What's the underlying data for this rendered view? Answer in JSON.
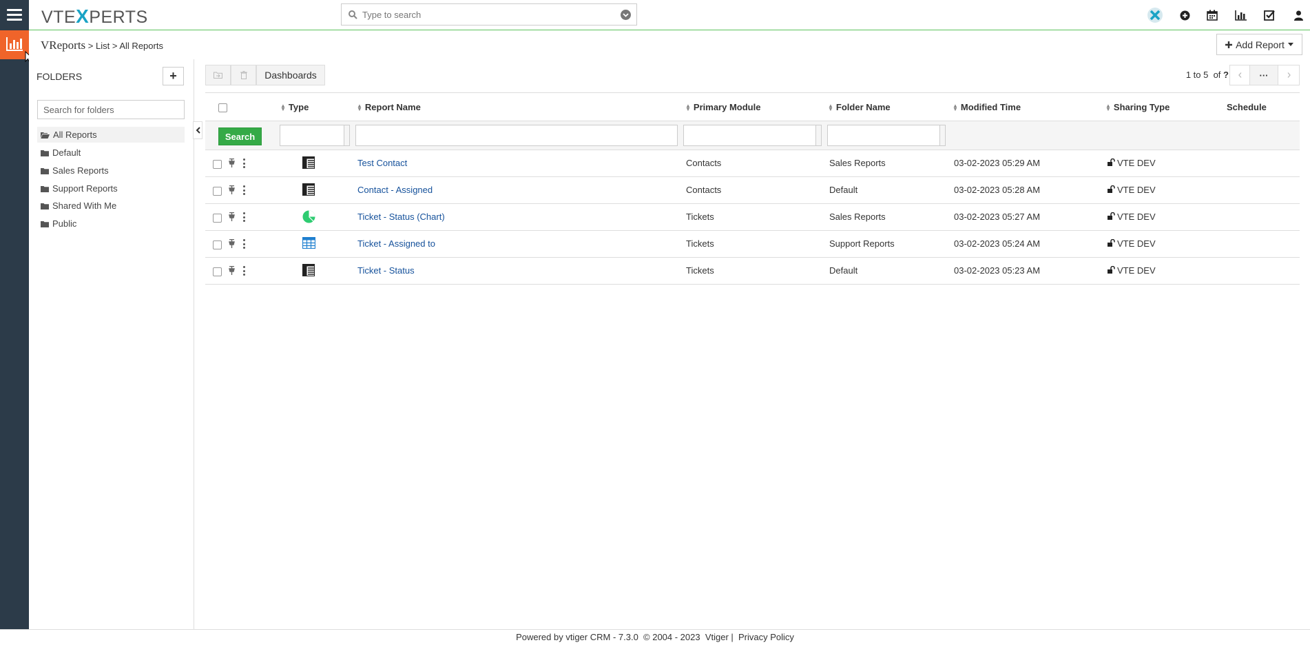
{
  "topbar": {
    "logo_left": "VTE",
    "logo_x": "X",
    "logo_right": "PERTS",
    "search_placeholder": "Type to search"
  },
  "breadcrumb": {
    "app": "VReports",
    "sep": ">",
    "list": "List",
    "current": "All Reports"
  },
  "add_report_label": "Add Report",
  "folders": {
    "title": "FOLDERS",
    "add_label": "+",
    "search_placeholder": "Search for folders",
    "items": [
      {
        "label": "All Reports"
      },
      {
        "label": "Default"
      },
      {
        "label": "Sales Reports"
      },
      {
        "label": "Support Reports"
      },
      {
        "label": "Shared With Me"
      },
      {
        "label": "Public"
      }
    ]
  },
  "toolbar": {
    "dashboards_label": "Dashboards",
    "pager_text": "1 to 5",
    "pager_of": "of",
    "pager_total": "?",
    "more_label": "···"
  },
  "table": {
    "headers": {
      "type": "Type",
      "report_name": "Report Name",
      "primary_module": "Primary Module",
      "folder_name": "Folder Name",
      "modified_time": "Modified Time",
      "sharing_type": "Sharing Type",
      "schedule": "Schedule"
    },
    "search_label": "Search",
    "rows": [
      {
        "type_icon": "tabular-report-icon",
        "name": "Test Contact",
        "module": "Contacts",
        "folder": "Sales Reports",
        "modified": "03-02-2023 05:29 AM",
        "sharing": "VTE DEV"
      },
      {
        "type_icon": "tabular-report-icon",
        "name": "Contact - Assigned",
        "module": "Contacts",
        "folder": "Default",
        "modified": "03-02-2023 05:28 AM",
        "sharing": "VTE DEV"
      },
      {
        "type_icon": "chart-report-icon",
        "name": "Ticket - Status (Chart)",
        "module": "Tickets",
        "folder": "Sales Reports",
        "modified": "03-02-2023 05:27 AM",
        "sharing": "VTE DEV"
      },
      {
        "type_icon": "grid-report-icon",
        "name": "Ticket - Assigned to",
        "module": "Tickets",
        "folder": "Support Reports",
        "modified": "03-02-2023 05:24 AM",
        "sharing": "VTE DEV"
      },
      {
        "type_icon": "tabular-report-icon",
        "name": "Ticket - Status",
        "module": "Tickets",
        "folder": "Default",
        "modified": "03-02-2023 05:23 AM",
        "sharing": "VTE DEV"
      }
    ]
  },
  "footer": {
    "text": "Powered by vtiger CRM - 7.3.0  © 2004 - 2023  Vtiger |  Privacy Policy"
  },
  "colors": {
    "brand_orange": "#f0642a",
    "sidebar_dark": "#2c3b49",
    "search_green": "#35aa47",
    "link_blue": "#15519b",
    "accent_teal": "#1aa3c5"
  }
}
